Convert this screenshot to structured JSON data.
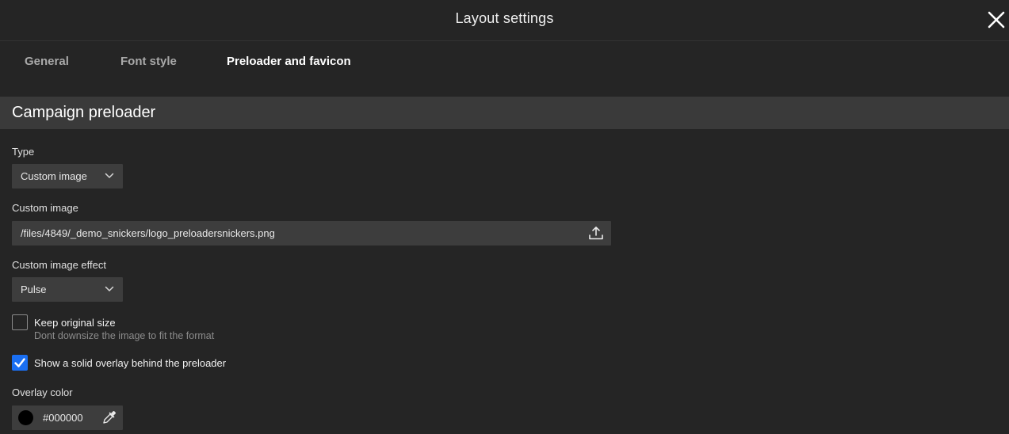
{
  "header": {
    "title": "Layout settings",
    "close_icon": "close-icon"
  },
  "tabs": [
    {
      "label": "General",
      "active": false
    },
    {
      "label": "Font style",
      "active": false
    },
    {
      "label": "Preloader and favicon",
      "active": true
    }
  ],
  "section": {
    "title": "Campaign preloader"
  },
  "type_field": {
    "label": "Type",
    "value": "Custom image",
    "icon": "chevron-down-icon"
  },
  "custom_image": {
    "label": "Custom image",
    "value": "/files/4849/_demo_snickers/logo_preloadersnickers.png",
    "icon": "upload-icon"
  },
  "effect_field": {
    "label": "Custom image effect",
    "value": "Pulse",
    "icon": "chevron-down-icon"
  },
  "keep_size": {
    "label": "Keep original size",
    "hint": "Dont downsize the image to fit the format",
    "checked": false
  },
  "overlay": {
    "label": "Show a solid overlay behind the preloader",
    "checked": true
  },
  "overlay_color": {
    "label": "Overlay color",
    "value": "#000000",
    "swatch": "#000000",
    "icon": "eyedropper-icon"
  },
  "colors": {
    "background": "#252525",
    "section": "#3a3a3a",
    "input": "#3d3d3d",
    "accent": "#1a6ff2"
  }
}
